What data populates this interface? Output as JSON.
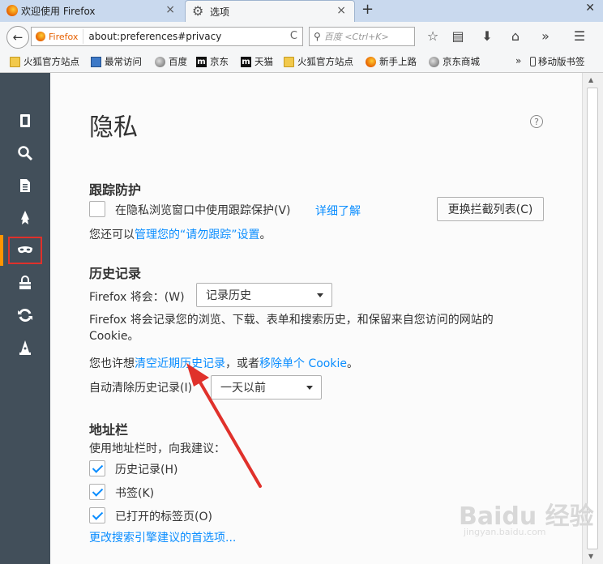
{
  "tabs": [
    {
      "label": "欢迎使用 Firefox",
      "close": "×"
    },
    {
      "label": "选项",
      "close": "×"
    }
  ],
  "newtab_glyph": "+",
  "window_close_glyph": "✕",
  "nav": {
    "back_glyph": "←",
    "identity_label": "Firefox",
    "url": "about:preferences#privacy",
    "reload_glyph": "C",
    "search_placeholder": "百度 <Ctrl+K>",
    "icons": [
      "star-icon",
      "reading-list-icon",
      "download-icon",
      "home-icon",
      "overflow-icon",
      "menu-icon"
    ],
    "icon_glyphs": [
      "☆",
      "▤",
      "⬇",
      "⌂",
      "»",
      "☰"
    ]
  },
  "bookmarks": [
    {
      "label": "火狐官方站点",
      "icon": "folder"
    },
    {
      "label": "最常访问",
      "icon": "blue"
    },
    {
      "label": "百度",
      "icon": "globe"
    },
    {
      "label": "京东",
      "icon": "m"
    },
    {
      "label": "天猫",
      "icon": "m"
    },
    {
      "label": "火狐官方站点",
      "icon": "folder"
    },
    {
      "label": "新手上路",
      "icon": "fx"
    },
    {
      "label": "京东商城",
      "icon": "globe"
    }
  ],
  "bookmarks_overflow": "»",
  "mobile_bookmarks": "移动版书签",
  "m_glyph": "m",
  "sidebar": {
    "categories": [
      "general-icon",
      "search-icon",
      "content-icon",
      "applications-icon",
      "privacy-icon",
      "security-icon",
      "sync-icon",
      "advanced-icon"
    ],
    "selected_index": 4
  },
  "page": {
    "title": "隐私",
    "help_glyph": "?",
    "tracking": {
      "heading": "跟踪防护",
      "checkbox_label": "在隐私浏览窗口中使用跟踪保护(V)",
      "learn_more": "详细了解",
      "change_list_button": "更换拦截列表(C)",
      "dnt_prefix": "您还可以",
      "dnt_link": "管理您的“请勿跟踪”设置",
      "dnt_suffix": "。"
    },
    "history": {
      "heading": "历史记录",
      "will_label": "Firefox 将会：(W)",
      "mode_value": "记录历史",
      "description": "Firefox 将会记录您的浏览、下载、表单和搜索历史，和保留来自您访问的网站的 Cookie。",
      "desc_line1": "Firefox 将会记录您的浏览、下载、表单和搜索历史，和保留来自您访问的网站的",
      "desc_line2": "Cookie。",
      "maybe_prefix": "您也许想",
      "clear_link": "清空近期历史记录",
      "mid_text": "，或者",
      "remove_cookie_link": "移除单个 Cookie",
      "maybe_suffix": "。",
      "auto_clear_label": "自动清除历史记录(I)",
      "auto_clear_value": "一天以前"
    },
    "locationbar": {
      "heading": "地址栏",
      "suggest_label": "使用地址栏时，向我建议：",
      "options": [
        {
          "label": "历史记录(H)",
          "checked": true
        },
        {
          "label": "书签(K)",
          "checked": true
        },
        {
          "label": "已打开的标签页(O)",
          "checked": true
        }
      ],
      "change_search_link": "更改搜索引擎建议的首选项..."
    }
  },
  "watermark": {
    "text": "Baidu 经验",
    "sub": "jingyan.baidu.com"
  },
  "colors": {
    "accent": "#0a8dff",
    "sidebar": "#424f5a",
    "annotation": "#e0312b",
    "selected_marker": "#ff9500"
  }
}
